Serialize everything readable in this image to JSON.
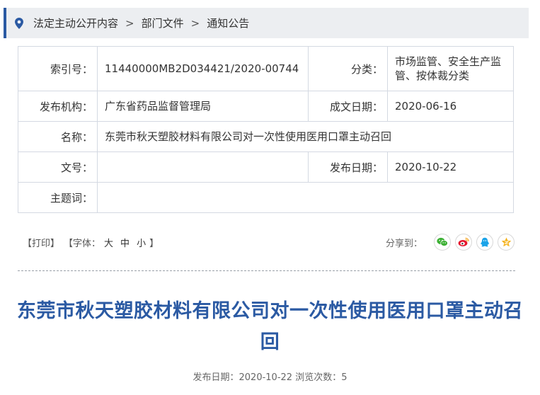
{
  "breadcrumb": {
    "items": [
      "法定主动公开内容",
      "部门文件",
      "通知公告"
    ],
    "separator": ">",
    "icon": "location-pin-icon"
  },
  "info": {
    "index_label": "索引号：",
    "index_value": "11440000MB2D034421/2020-00744",
    "category_label": "分类：",
    "category_value": "市场监管、安全生产监管、按体裁分类",
    "publisher_label": "发布机构：",
    "publisher_value": "广东省药品监督管理局",
    "created_label": "成文日期：",
    "created_value": "2020-06-16",
    "name_label": "名称：",
    "name_value": "东莞市秋天塑胶材料有限公司对一次性使用医用口罩主动召回",
    "docno_label": "文号：",
    "docno_value": "",
    "pubdate_label": "发布日期：",
    "pubdate_value": "2020-10-22",
    "keywords_label": "主题词：",
    "keywords_value": ""
  },
  "toolbar": {
    "print": "【打印】",
    "font_prefix": "【字体：",
    "font_large": "大",
    "font_medium": "中",
    "font_small": "小",
    "font_suffix": "】",
    "share_label": "分享到：",
    "share_icons": [
      "wechat-icon",
      "weibo-icon",
      "qq-icon",
      "qzone-icon"
    ]
  },
  "article": {
    "title": "东莞市秋天塑胶材料有限公司对一次性使用医用口罩主动召回",
    "meta": "发布日期：2020-10-22  浏览次数：5"
  },
  "colors": {
    "accent": "#2b5aa3",
    "breadcrumb_bg": "#eceef1",
    "table_border": "#d4d9e2",
    "wechat": "#3cb034",
    "weibo": "#e6162d",
    "qq": "#1aa3e8",
    "qzone": "#f5b21b"
  }
}
